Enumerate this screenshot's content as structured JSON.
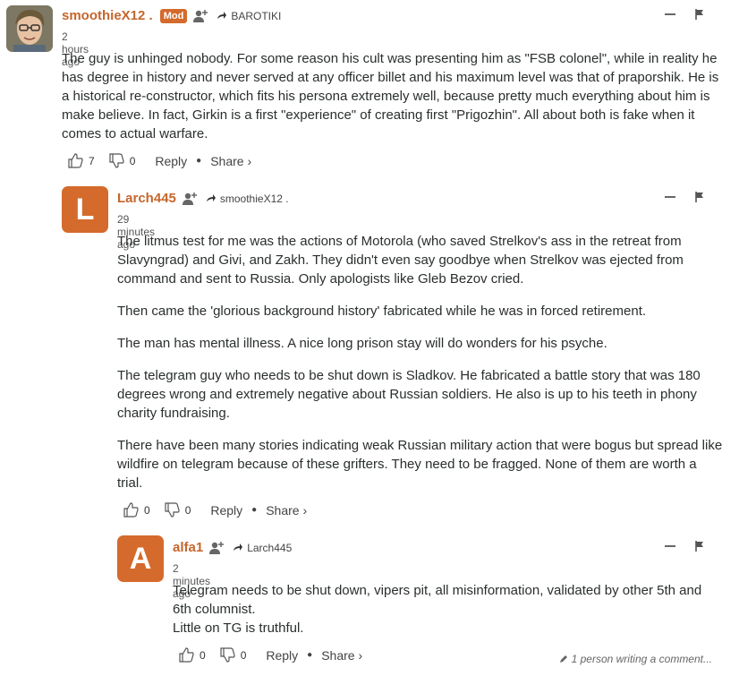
{
  "colors": {
    "accent": "#c5662b",
    "avatar_bg": "#d46a2c",
    "text": "#2a2e2e"
  },
  "comments": [
    {
      "author": "smoothieX12 .",
      "badge": "Mod",
      "reply_to": "BAROTIKI",
      "time": "2 hours ago",
      "paragraphs": [
        "The guy is unhinged nobody. For some reason his cult was presenting him as \"FSB colonel\", while in reality he has degree in history and never served at any officer billet and his maximum level was that of praporshik. He is a historical re-constructor, which fits his persona extremely well, because pretty much everything about him is make believe. In fact, Girkin is a first \"experience\" of creating first \"Prigozhin\". All about both is fake when it comes to actual warfare."
      ],
      "upvotes": "7",
      "downvotes": "0",
      "reply_label": "Reply",
      "share_label": "Share ›"
    },
    {
      "author": "Larch445",
      "avatar_letter": "L",
      "reply_to": "smoothieX12 .",
      "time": "29 minutes ago",
      "paragraphs": [
        "The litmus test for me was the actions of Motorola (who saved Strelkov's ass in the retreat from Slavyngrad) and Givi, and Zakh. They didn't even say goodbye when Strelkov was ejected from command and sent to Russia. Only apologists like Gleb Bezov cried.",
        "Then came the 'glorious background history' fabricated while he was in forced retirement.",
        "The man has mental illness. A nice long prison stay will do wonders for his psyche.",
        "The telegram guy who needs to be shut down is Sladkov. He fabricated a battle story that was 180 degrees wrong and extremely negative about Russian soldiers. He also is up to his teeth in phony charity fundraising.",
        "There have been many stories indicating weak Russian military action that were bogus but spread like wildfire on telegram because of these grifters. They need to be fragged. None of them are worth a trial."
      ],
      "upvotes": "0",
      "downvotes": "0",
      "reply_label": "Reply",
      "share_label": "Share ›"
    },
    {
      "author": "alfa1",
      "avatar_letter": "A",
      "reply_to": "Larch445",
      "time": "2 minutes ago",
      "line1": "Telegram needs to be shut down, vipers pit, all misinformation, validated by other 5th and 6th columnist.",
      "line2": "Little on TG is truthful.",
      "upvotes": "0",
      "downvotes": "0",
      "reply_label": "Reply",
      "share_label": "Share ›"
    }
  ],
  "typing_indicator": "1 person writing a comment..."
}
